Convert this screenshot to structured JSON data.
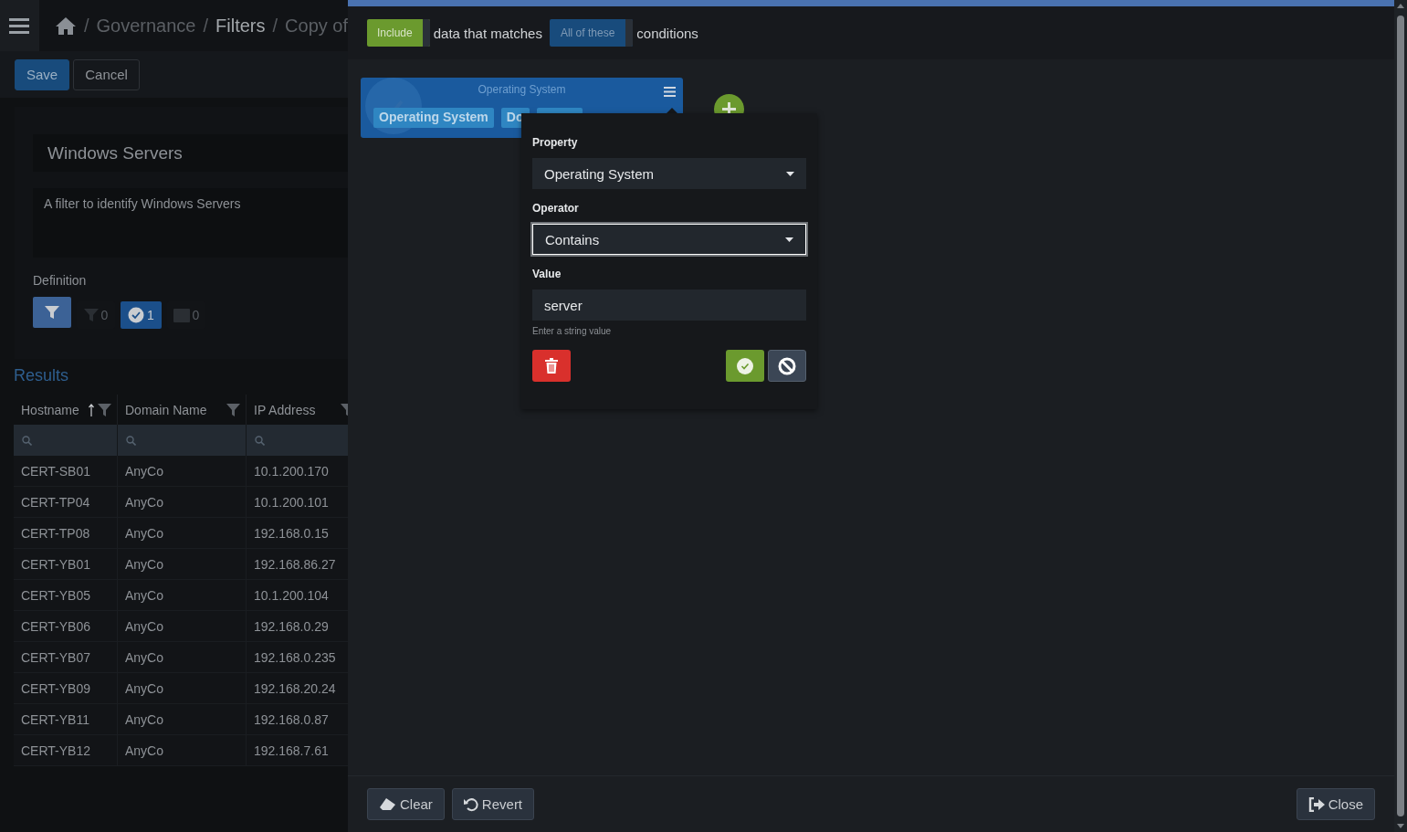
{
  "breadcrumb": [
    {
      "separator": "/",
      "label": "Governance"
    },
    {
      "separator": "/",
      "label": "Filters"
    },
    {
      "separator": "/",
      "label": "Copy of"
    }
  ],
  "toolbar": {
    "save": "Save",
    "cancel": "Cancel"
  },
  "filter": {
    "name": "Windows Servers",
    "description": "A filter to identify Windows Servers"
  },
  "definition": {
    "label": "Definition",
    "tabs": [
      {
        "kind": "funnel",
        "selected": true
      },
      {
        "kind": "funnel",
        "count": "0",
        "selected": false
      },
      {
        "kind": "check",
        "count": "1",
        "selected": false
      },
      {
        "kind": "calendar",
        "count": "0",
        "selected": false
      }
    ]
  },
  "results": {
    "title": "Results",
    "columns": [
      {
        "label": "Hostname",
        "sorted": true
      },
      {
        "label": "Domain Name",
        "sorted": false
      },
      {
        "label": "IP Address",
        "sorted": false
      }
    ],
    "rows": [
      [
        "CERT-SB01",
        "AnyCo",
        "10.1.200.170"
      ],
      [
        "CERT-TP04",
        "AnyCo",
        "10.1.200.101"
      ],
      [
        "CERT-TP08",
        "AnyCo",
        "192.168.0.15"
      ],
      [
        "CERT-YB01",
        "AnyCo",
        "192.168.86.27"
      ],
      [
        "CERT-YB05",
        "AnyCo",
        "10.1.200.104"
      ],
      [
        "CERT-YB06",
        "AnyCo",
        "192.168.0.29"
      ],
      [
        "CERT-YB07",
        "AnyCo",
        "192.168.0.235"
      ],
      [
        "CERT-YB09",
        "AnyCo",
        "192.168.20.24"
      ],
      [
        "CERT-YB11",
        "AnyCo",
        "192.168.0.87"
      ],
      [
        "CERT-YB12",
        "AnyCo",
        "192.168.7.61"
      ]
    ]
  },
  "editor": {
    "mode": "Include",
    "middle": "data that matches",
    "match": "All of these",
    "end": "conditions",
    "rule": {
      "title": "Operating System",
      "chips": [
        "Operating System",
        "Do"
      ]
    },
    "popover": {
      "property_label": "Property",
      "property": "Operating System",
      "operator_label": "Operator",
      "operator": "Contains",
      "value_label": "Value",
      "value": "server",
      "hint": "Enter a string value"
    },
    "footer": {
      "clear": "Clear",
      "revert": "Revert",
      "close": "Close"
    }
  }
}
